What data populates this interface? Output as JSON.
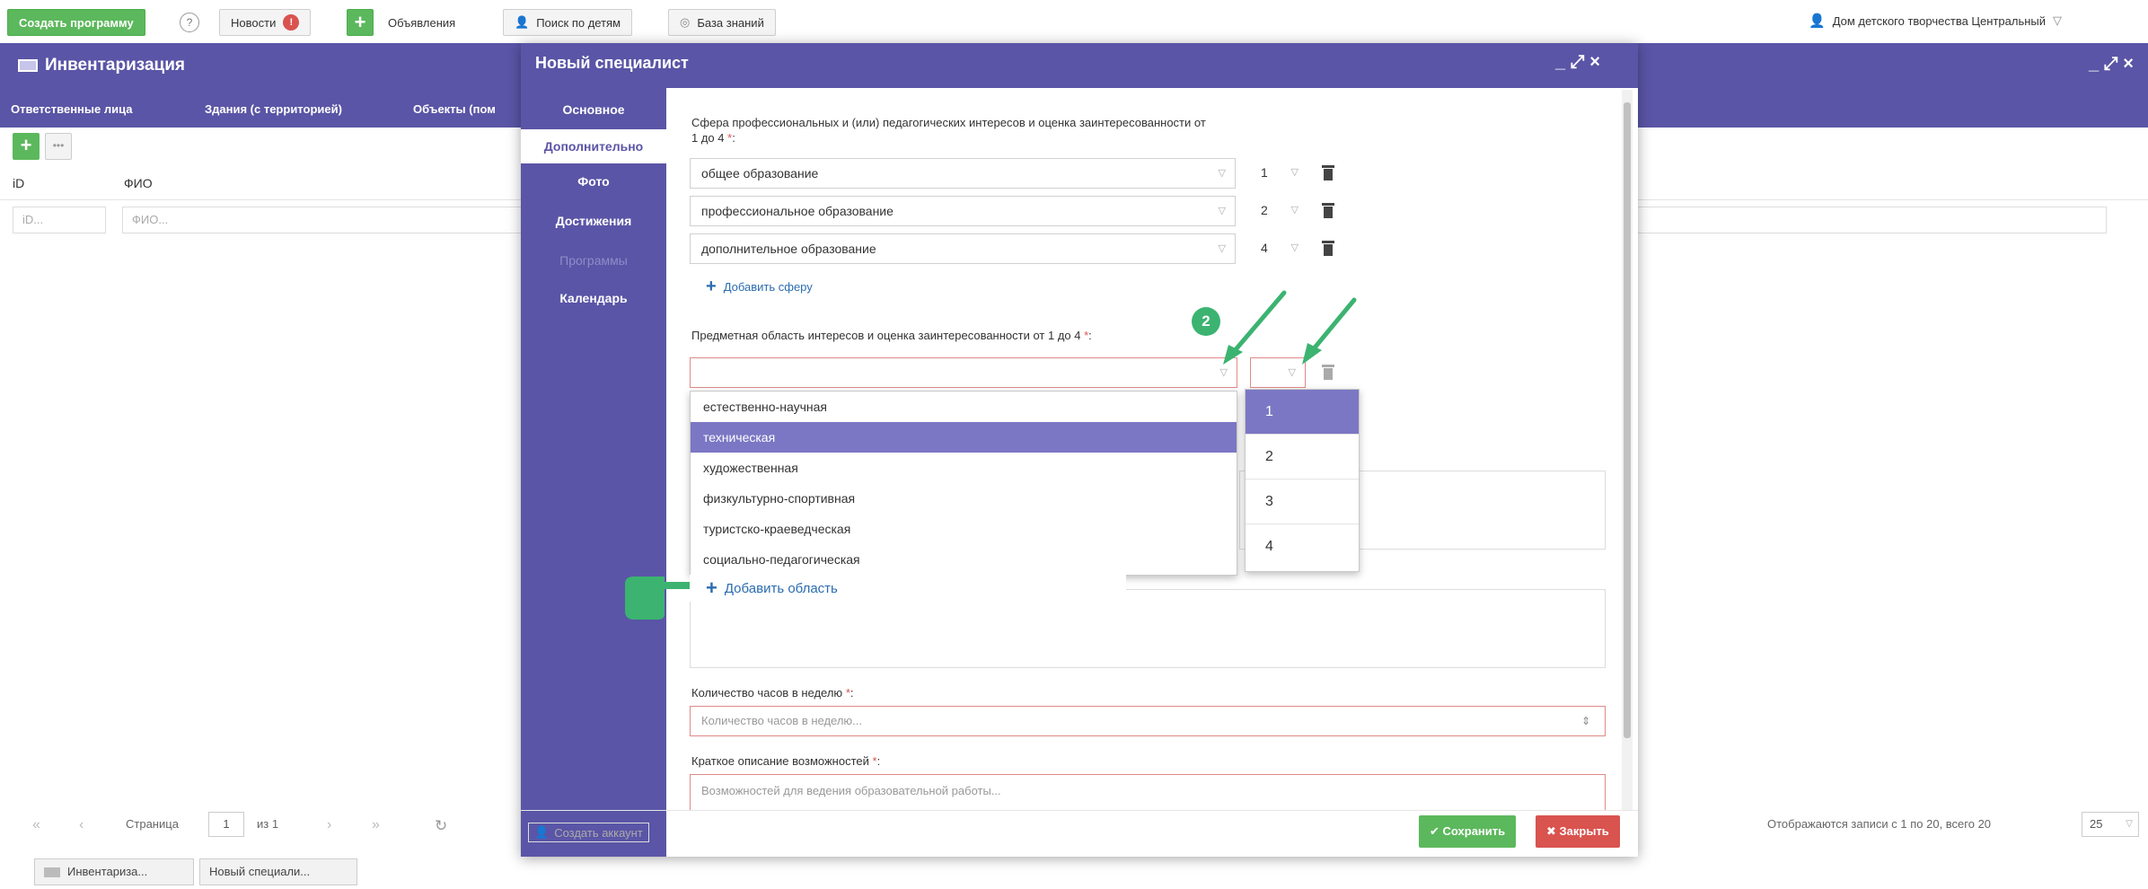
{
  "toolbar": {
    "create_program": "Создать программу",
    "help": "?",
    "news": "Новости",
    "news_badge": "!",
    "add": "+",
    "ads": "Объявления",
    "child_search": "Поиск по детям",
    "knowledge_base": "База знаний",
    "org": "Дом детского творчества Центральный"
  },
  "bg_window": {
    "title": "Инвентаризация",
    "controls": "_ ⤢ ×",
    "tabs": [
      "Ответственные лица",
      "Здания (с территорией)",
      "Объекты (пом"
    ],
    "more_btn": "•••",
    "columns": {
      "id": "iD",
      "fio": "ФИО"
    },
    "filter_placeholders": {
      "id": "iD...",
      "fio": "ФИО..."
    },
    "pager": {
      "page_label": "Страница",
      "page": "1",
      "of": "из 1",
      "records": "Отображаются записи с 1 по 20, всего 20",
      "per_page": "25"
    }
  },
  "modal": {
    "title": "Новый специалист",
    "controls": "_ ⤢ ×",
    "sidebar": [
      "Основное",
      "Дополнительно",
      "Фото",
      "Достижения",
      "Программы",
      "Календарь"
    ],
    "sphere_label": "Сфера профессиональных и (или) педагогических интересов и оценка заинтересованности от",
    "sphere_label2": "1 до 4",
    "required": "*",
    "colon": ":",
    "spheres": [
      {
        "name": "общее образование",
        "score": "1"
      },
      {
        "name": "профессиональное образование",
        "score": "2"
      },
      {
        "name": "дополнительное образование",
        "score": "4"
      }
    ],
    "add_sphere": "Добавить сферу",
    "subject_label": "Предметная область интересов и оценка заинтересованности от 1 до 4",
    "subject_options": [
      "естественно-научная",
      "техническая",
      "художественная",
      "физкультурно-спортивная",
      "туристско-краеведческая",
      "социально-педагогическая"
    ],
    "score_options": [
      "1",
      "2",
      "3",
      "4"
    ],
    "add_area": "Добавить область",
    "hours_label": "Количество часов в неделю",
    "hours_placeholder": "Количество часов в неделю...",
    "desc_label": "Краткое описание возможностей",
    "desc_placeholder": "Возможностей для ведения образовательной работы...",
    "create_account": "Создать аккаунт",
    "save": "Сохранить",
    "close": "Закрыть"
  },
  "annotation": {
    "step": "2"
  },
  "taskbar": [
    "Инвентариза...",
    "Новый специали..."
  ],
  "colors": {
    "accent": "#5a55a6",
    "highlight": "#7b77c4",
    "green": "#5cb85c",
    "red": "#d9534f",
    "annotation": "#3cb371"
  }
}
